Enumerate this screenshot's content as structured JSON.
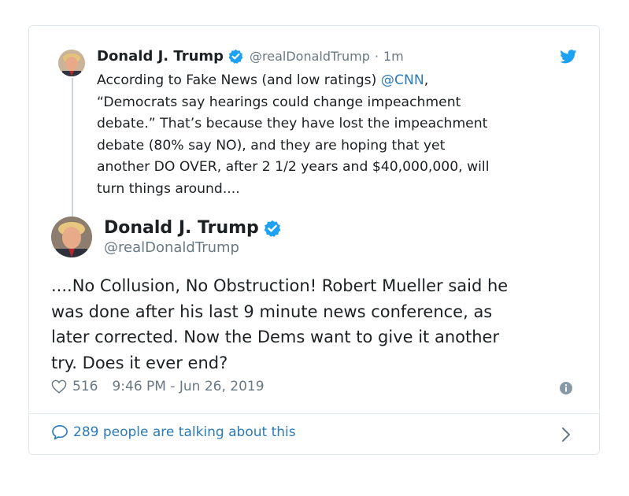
{
  "parent_tweet": {
    "author_name": "Donald J. Trump",
    "handle": "@realDonaldTrump",
    "separator": "·",
    "time": "1m",
    "text_before_mention": "According to Fake News (and low ratings) ",
    "mention": "@CNN",
    "text_after_mention": ",\n“Democrats say hearings could change impeachment\ndebate.” That’s because they have lost the impeachment\ndebate (80% say NO), and they are hoping that yet\nanother DO OVER, after 2 1/2 years and $40,000,000, will\nturn things around...."
  },
  "main_tweet": {
    "author_name": "Donald J. Trump",
    "handle": "@realDonaldTrump",
    "text": "....No Collusion, No Obstruction! Robert Mueller said he\nwas done after his last 9 minute news conference, as\nlater corrected. Now the Dems want to  give it another\ntry. Does it ever end?",
    "likes": "516",
    "timestamp": "9:46 PM - Jun 26, 2019"
  },
  "footer": {
    "label": "289 people are talking about this"
  },
  "icons": {
    "verified": "verified-badge-icon",
    "twitter": "twitter-bird-icon",
    "like": "heart-icon",
    "info": "info-icon",
    "reply": "speech-bubble-icon",
    "chevron": "chevron-right-icon"
  },
  "colors": {
    "accent": "#1da1f2",
    "link": "#2b7bb9",
    "muted": "#697882",
    "border": "#e1e8ed",
    "text": "#1c2022"
  }
}
